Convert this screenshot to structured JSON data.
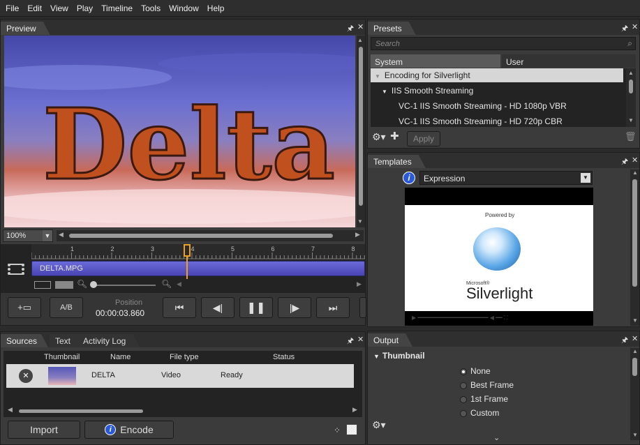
{
  "menu": [
    "File",
    "Edit",
    "View",
    "Play",
    "Timeline",
    "Tools",
    "Window",
    "Help"
  ],
  "preview": {
    "tab": "Preview",
    "zoom": "100%"
  },
  "timeline": {
    "ruler": [
      "1",
      "2",
      "3",
      "4",
      "5",
      "6",
      "7",
      "8"
    ],
    "clip_name": "DELTA.MPG"
  },
  "transport": {
    "ab_label": "A/B",
    "position_label": "Position",
    "timecode": "00:00:03.860"
  },
  "sources": {
    "tabs": [
      "Sources",
      "Text",
      "Activity Log"
    ],
    "columns": [
      "Thumbnail",
      "Name",
      "File type",
      "Status"
    ],
    "rows": [
      {
        "name": "DELTA",
        "file_type": "Video",
        "status": "Ready"
      }
    ],
    "import_label": "Import",
    "encode_label": "Encode"
  },
  "presets": {
    "tab": "Presets",
    "search_placeholder": "Search",
    "subtabs": [
      "System",
      "User"
    ],
    "items": [
      {
        "label": "Encoding for Silverlight",
        "level": 0
      },
      {
        "label": "IIS Smooth Streaming",
        "level": 1
      },
      {
        "label": "VC-1 IIS Smooth Streaming - HD 1080p VBR",
        "level": 2
      },
      {
        "label": "VC-1 IIS Smooth Streaming - HD 720p CBR",
        "level": 2
      }
    ],
    "apply_label": "Apply"
  },
  "templates": {
    "tab": "Templates",
    "selected": "Expression",
    "powered_by": "Powered by",
    "brand_small": "Microsoft®",
    "brand": "Silverlight"
  },
  "output": {
    "tab": "Output",
    "section": "Thumbnail",
    "options": [
      "None",
      "Best Frame",
      "1st Frame",
      "Custom"
    ],
    "selected_index": 0
  }
}
